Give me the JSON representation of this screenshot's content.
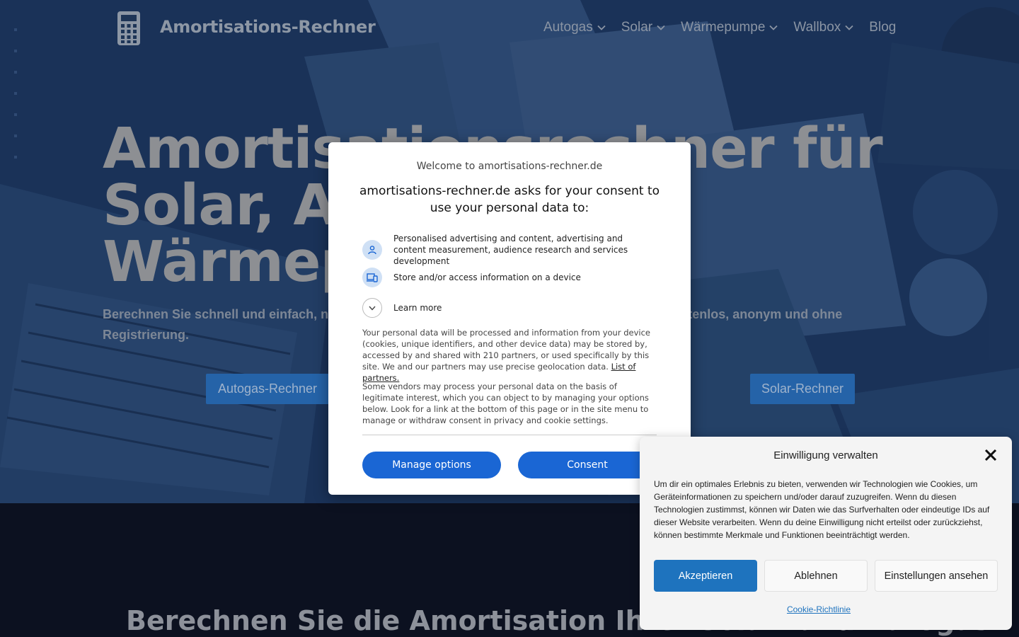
{
  "header": {
    "logo_text": "Amortisations-Rechner",
    "nav": [
      {
        "label": "Autogas",
        "has_dropdown": true
      },
      {
        "label": "Solar",
        "has_dropdown": true
      },
      {
        "label": "Wärmepumpe",
        "has_dropdown": true
      },
      {
        "label": "Wallbox",
        "has_dropdown": true
      },
      {
        "label": "Blog",
        "has_dropdown": false
      }
    ]
  },
  "hero": {
    "title_line1": "Amortisationsrechner für",
    "title_line2": "Solar, Autogas und",
    "title_line3": "Wärmepumpe",
    "subtitle": "Berechnen Sie schnell und einfach, nach wie vielen Jahren sich Ihre Investition amortisiert – kostenlos, anonym und ohne Registrierung.",
    "cta_autogas": "Autogas-Rechner",
    "cta_solar": "Solar-Rechner"
  },
  "section": {
    "title": "Berechnen Sie die Amortisation Ihrer Solar- und Autogas"
  },
  "consent_modal": {
    "welcome": "Welcome to amortisations-rechner.de",
    "heading": "amortisations-rechner.de asks for your consent to use your personal data to:",
    "purposes": [
      {
        "icon": "person-icon",
        "text": "Personalised advertising and content, advertising and content measurement, audience research and services development"
      },
      {
        "icon": "devices-icon",
        "text": "Store and/or access information on a device"
      }
    ],
    "learn_more": "Learn more",
    "para1": "Your personal data will be processed and information from your device (cookies, unique identifiers, and other device data) may be stored by, accessed by and shared with 210 partners, or used specifically by this site. We and our partners may use precise geolocation data.",
    "partners_link": "List of partners.",
    "para2": "Some vendors may process your personal data on the basis of legitimate interest, which you can object to by managing your options below. Look for a link at the bottom of this page or in the site menu to manage or withdraw consent in privacy and cookie settings.",
    "manage_btn": "Manage options",
    "consent_btn": "Consent",
    "accent_color": "#1a66d4"
  },
  "cookie_panel": {
    "title": "Einwilligung verwalten",
    "text": "Um dir ein optimales Erlebnis zu bieten, verwenden wir Technologien wie Cookies, um Geräteinformationen zu speichern und/oder darauf zuzugreifen. Wenn du diesen Technologien zustimmst, können wir Daten wie das Surfverhalten oder eindeutige IDs auf dieser Website verarbeiten. Wenn du deine Einwilligung nicht erteilst oder zurückziehst, können bestimmte Merkmale und Funktionen beeinträchtigt werden.",
    "accept": "Akzeptieren",
    "deny": "Ablehnen",
    "settings": "Einstellungen ansehen",
    "policy_link": "Cookie-Richtlinie",
    "accent_color": "#1e73be"
  }
}
